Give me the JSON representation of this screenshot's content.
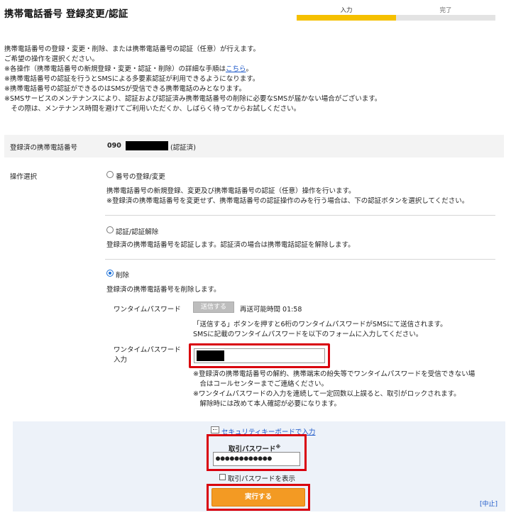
{
  "header": {
    "title": "携帯電話番号 登録変更/認証"
  },
  "progress": {
    "steps": [
      "入力",
      "完了"
    ],
    "current_step": 1
  },
  "notes": {
    "lines": [
      "携帯電話番号の登録・変更・削除、または携帯電話番号の認証（任意）が行えます。",
      "ご希望の操作を選択ください。",
      "※各操作（携帯電話番号の新規登録・変更・認証・削除）の詳細な手順は",
      "※携帯電話番号の認証を行うとSMSによる多要素認証が利用できるようになります。",
      "※携帯電話番号の認証ができるのはSMSが受信できる携帯電話のみとなります。",
      "※SMSサービスのメンテナンスにより、認証および認証済み携帯電話番号の削除に必要なSMSが届かない場合がございます。",
      "　その際は、メンテナンス時間を避けてご利用いただくか、しばらく待ってからお試しください。"
    ],
    "link_text": "こちら",
    "link_suffix": "。"
  },
  "registered": {
    "label": "登録済の携帯電話番号",
    "phone_prefix": "090",
    "status": "(認証済)"
  },
  "operation": {
    "label": "操作選択",
    "options": [
      {
        "title": "番号の登録/変更",
        "selected": false,
        "desc": [
          "携帯電話番号の新規登録、変更及び携帯電話番号の認証（任意）操作を行います。",
          "※登録済の携帯電話番号を変更せず、携帯電話番号の認証操作のみを行う場合は、下の認証ボタンを選択してください。"
        ]
      },
      {
        "title": "認証/認証解除",
        "selected": false,
        "desc": [
          "登録済の携帯電話番号を認証します。認証済の場合は携帯電話認証を解除します。"
        ]
      },
      {
        "title": "削除",
        "selected": true,
        "desc": [
          "登録済の携帯電話番号を削除します。"
        ]
      }
    ]
  },
  "otp": {
    "label": "ワンタイムパスワード",
    "send_button": "送信する",
    "resend_text": "再送可能時間 01:58",
    "info": [
      "「送信する」ボタンを押すと6桁のワンタイムパスワードがSMSにて送信されます。",
      "SMSに記載のワンタイムパスワードを以下のフォームに入力してください。"
    ],
    "input_label_1": "ワンタイムパスワード",
    "input_label_2": "入力",
    "warnings": [
      "※登録済の携帯電話番号の解約、携帯端末の紛失等でワンタイムパスワードを受信できない場",
      "　合はコールセンターまでご連絡ください。",
      "※ワンタイムパスワードの入力を連続して一定回数以上誤ると、取引がロックされます。",
      "　解除時には改めて本人確認が必要になります。"
    ]
  },
  "confirm": {
    "keyboard_link": "セキュリティキーボードで入力",
    "password_label": "取引パスワード",
    "password_mark": "※",
    "password_masked": "●●●●●●●●●●●●",
    "show_password_label": "取引パスワードを表示",
    "execute_button": "実行する",
    "cancel_link": "[中止]"
  },
  "colors": {
    "accent_yellow": "#f5c000",
    "highlight_red": "#d9000d",
    "execute_orange": "#f39a23",
    "link_blue": "#1a56c8",
    "panel_bg": "#edf2f9"
  }
}
